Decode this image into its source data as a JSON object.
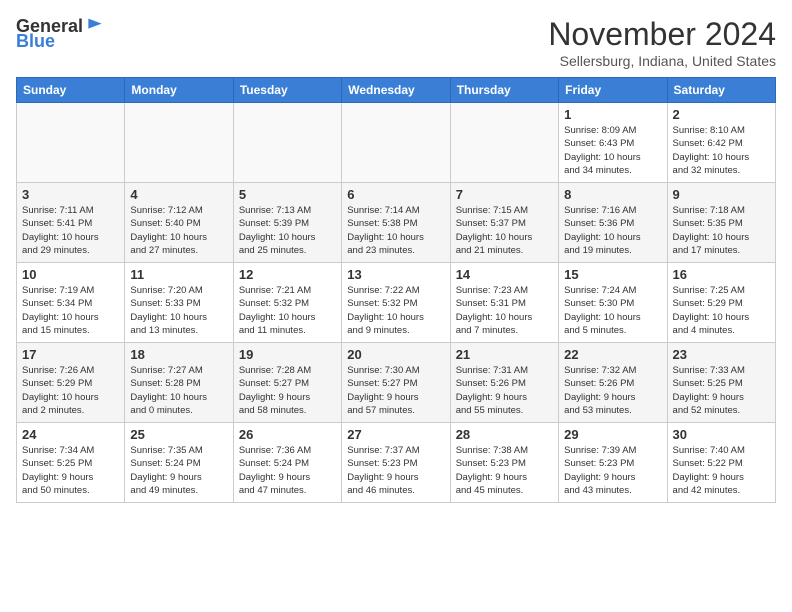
{
  "header": {
    "logo_general": "General",
    "logo_blue": "Blue",
    "month_title": "November 2024",
    "location": "Sellersburg, Indiana, United States"
  },
  "calendar": {
    "days_of_week": [
      "Sunday",
      "Monday",
      "Tuesday",
      "Wednesday",
      "Thursday",
      "Friday",
      "Saturday"
    ],
    "weeks": [
      [
        {
          "day": "",
          "info": ""
        },
        {
          "day": "",
          "info": ""
        },
        {
          "day": "",
          "info": ""
        },
        {
          "day": "",
          "info": ""
        },
        {
          "day": "",
          "info": ""
        },
        {
          "day": "1",
          "info": "Sunrise: 8:09 AM\nSunset: 6:43 PM\nDaylight: 10 hours\nand 34 minutes."
        },
        {
          "day": "2",
          "info": "Sunrise: 8:10 AM\nSunset: 6:42 PM\nDaylight: 10 hours\nand 32 minutes."
        }
      ],
      [
        {
          "day": "3",
          "info": "Sunrise: 7:11 AM\nSunset: 5:41 PM\nDaylight: 10 hours\nand 29 minutes."
        },
        {
          "day": "4",
          "info": "Sunrise: 7:12 AM\nSunset: 5:40 PM\nDaylight: 10 hours\nand 27 minutes."
        },
        {
          "day": "5",
          "info": "Sunrise: 7:13 AM\nSunset: 5:39 PM\nDaylight: 10 hours\nand 25 minutes."
        },
        {
          "day": "6",
          "info": "Sunrise: 7:14 AM\nSunset: 5:38 PM\nDaylight: 10 hours\nand 23 minutes."
        },
        {
          "day": "7",
          "info": "Sunrise: 7:15 AM\nSunset: 5:37 PM\nDaylight: 10 hours\nand 21 minutes."
        },
        {
          "day": "8",
          "info": "Sunrise: 7:16 AM\nSunset: 5:36 PM\nDaylight: 10 hours\nand 19 minutes."
        },
        {
          "day": "9",
          "info": "Sunrise: 7:18 AM\nSunset: 5:35 PM\nDaylight: 10 hours\nand 17 minutes."
        }
      ],
      [
        {
          "day": "10",
          "info": "Sunrise: 7:19 AM\nSunset: 5:34 PM\nDaylight: 10 hours\nand 15 minutes."
        },
        {
          "day": "11",
          "info": "Sunrise: 7:20 AM\nSunset: 5:33 PM\nDaylight: 10 hours\nand 13 minutes."
        },
        {
          "day": "12",
          "info": "Sunrise: 7:21 AM\nSunset: 5:32 PM\nDaylight: 10 hours\nand 11 minutes."
        },
        {
          "day": "13",
          "info": "Sunrise: 7:22 AM\nSunset: 5:32 PM\nDaylight: 10 hours\nand 9 minutes."
        },
        {
          "day": "14",
          "info": "Sunrise: 7:23 AM\nSunset: 5:31 PM\nDaylight: 10 hours\nand 7 minutes."
        },
        {
          "day": "15",
          "info": "Sunrise: 7:24 AM\nSunset: 5:30 PM\nDaylight: 10 hours\nand 5 minutes."
        },
        {
          "day": "16",
          "info": "Sunrise: 7:25 AM\nSunset: 5:29 PM\nDaylight: 10 hours\nand 4 minutes."
        }
      ],
      [
        {
          "day": "17",
          "info": "Sunrise: 7:26 AM\nSunset: 5:29 PM\nDaylight: 10 hours\nand 2 minutes."
        },
        {
          "day": "18",
          "info": "Sunrise: 7:27 AM\nSunset: 5:28 PM\nDaylight: 10 hours\nand 0 minutes."
        },
        {
          "day": "19",
          "info": "Sunrise: 7:28 AM\nSunset: 5:27 PM\nDaylight: 9 hours\nand 58 minutes."
        },
        {
          "day": "20",
          "info": "Sunrise: 7:30 AM\nSunset: 5:27 PM\nDaylight: 9 hours\nand 57 minutes."
        },
        {
          "day": "21",
          "info": "Sunrise: 7:31 AM\nSunset: 5:26 PM\nDaylight: 9 hours\nand 55 minutes."
        },
        {
          "day": "22",
          "info": "Sunrise: 7:32 AM\nSunset: 5:26 PM\nDaylight: 9 hours\nand 53 minutes."
        },
        {
          "day": "23",
          "info": "Sunrise: 7:33 AM\nSunset: 5:25 PM\nDaylight: 9 hours\nand 52 minutes."
        }
      ],
      [
        {
          "day": "24",
          "info": "Sunrise: 7:34 AM\nSunset: 5:25 PM\nDaylight: 9 hours\nand 50 minutes."
        },
        {
          "day": "25",
          "info": "Sunrise: 7:35 AM\nSunset: 5:24 PM\nDaylight: 9 hours\nand 49 minutes."
        },
        {
          "day": "26",
          "info": "Sunrise: 7:36 AM\nSunset: 5:24 PM\nDaylight: 9 hours\nand 47 minutes."
        },
        {
          "day": "27",
          "info": "Sunrise: 7:37 AM\nSunset: 5:23 PM\nDaylight: 9 hours\nand 46 minutes."
        },
        {
          "day": "28",
          "info": "Sunrise: 7:38 AM\nSunset: 5:23 PM\nDaylight: 9 hours\nand 45 minutes."
        },
        {
          "day": "29",
          "info": "Sunrise: 7:39 AM\nSunset: 5:23 PM\nDaylight: 9 hours\nand 43 minutes."
        },
        {
          "day": "30",
          "info": "Sunrise: 7:40 AM\nSunset: 5:22 PM\nDaylight: 9 hours\nand 42 minutes."
        }
      ]
    ]
  }
}
